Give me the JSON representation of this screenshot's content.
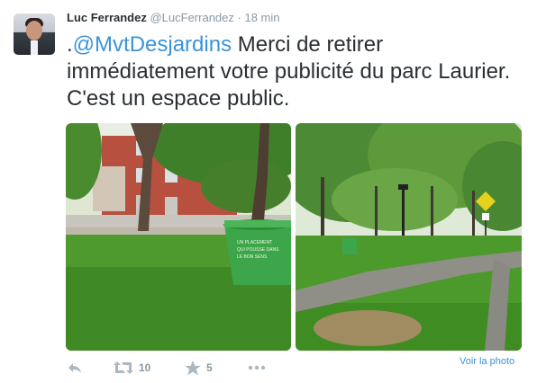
{
  "tweet": {
    "author_name": "Luc Ferrandez",
    "handle": "@LucFerrandez",
    "separator": "·",
    "time": "18 min",
    "text_prefix": ".",
    "mention": "@MvtDesjardins",
    "text_body": " Merci de retirer immédiatement votre publicité du parc Laurier. C'est un espace public.",
    "planter_lines": [
      "UN PLACEMENT",
      "QUI POUSSE DANS",
      "LE BON SENS"
    ]
  },
  "actions": {
    "reply_icon": "reply-icon",
    "retweet_icon": "retweet-icon",
    "retweet_count": "10",
    "favorite_icon": "star-icon",
    "favorite_count": "5",
    "more_icon": "more-icon"
  },
  "view_photo_label": "Voir la photo",
  "colors": {
    "link": "#3b94d9",
    "meta": "#8899a6",
    "text": "#292f33",
    "grass": "#4f9a2e",
    "planter": "#3ea64a"
  }
}
